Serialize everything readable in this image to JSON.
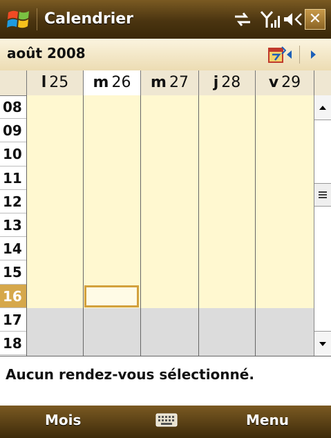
{
  "titlebar": {
    "title": "Calendrier",
    "close_label": "✕"
  },
  "month": {
    "label": "août 2008"
  },
  "days": [
    {
      "letter": "l",
      "num": "25",
      "selected": false
    },
    {
      "letter": "m",
      "num": "26",
      "selected": true
    },
    {
      "letter": "m",
      "num": "27",
      "selected": false
    },
    {
      "letter": "j",
      "num": "28",
      "selected": false
    },
    {
      "letter": "v",
      "num": "29",
      "selected": false
    }
  ],
  "hours": [
    "08",
    "09",
    "10",
    "11",
    "12",
    "13",
    "14",
    "15",
    "16",
    "17",
    "18"
  ],
  "current_hour": "16",
  "status": {
    "text": "Aucun rendez-vous sélectionné."
  },
  "softkeys": {
    "left": "Mois",
    "right": "Menu"
  },
  "colors": {
    "work_hours": "#fff8d0",
    "off_hours": "#dcdcdc",
    "accent": "#d3a13d",
    "title_bar": "#4a3410"
  },
  "icons": [
    "windows-logo-icon",
    "sync-icon",
    "signal-icon",
    "volume-icon",
    "close-icon",
    "today-icon",
    "prev-arrow-icon",
    "next-arrow-icon",
    "scroll-up-icon",
    "scroll-down-icon",
    "keyboard-icon"
  ]
}
